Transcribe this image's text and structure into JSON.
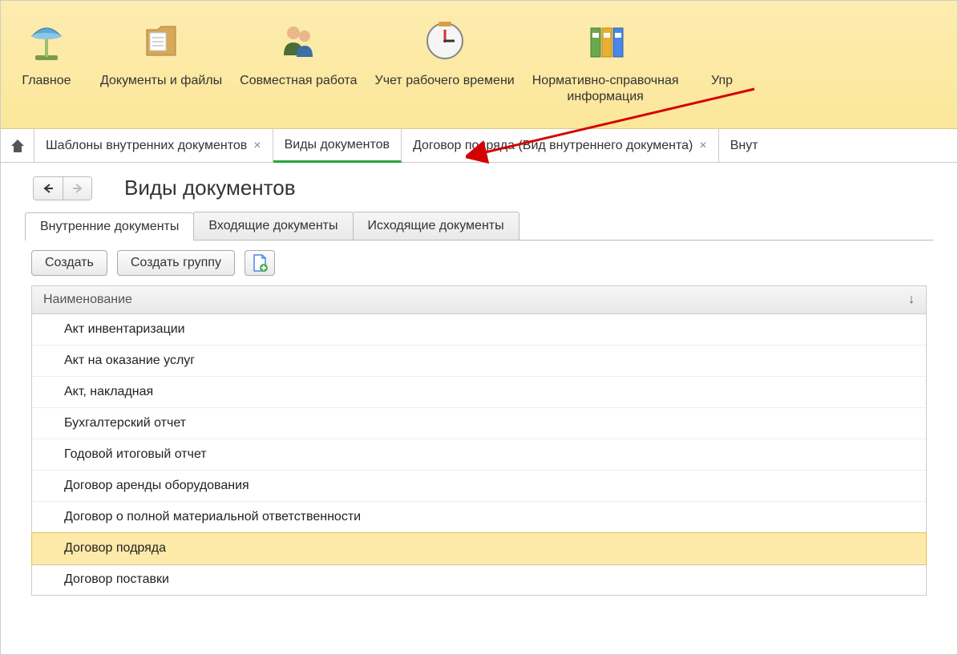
{
  "ribbon": [
    {
      "label": "Главное",
      "icon": "lamp"
    },
    {
      "label": "Документы и файлы",
      "icon": "folder"
    },
    {
      "label": "Совместная работа",
      "icon": "people"
    },
    {
      "label": "Учет рабочего времени",
      "icon": "clock"
    },
    {
      "label": "Нормативно-справочная\nинформация",
      "icon": "binders"
    },
    {
      "label": "Упр",
      "icon": "none"
    }
  ],
  "tabs": [
    {
      "label": "Шаблоны внутренних документов",
      "closable": true,
      "active": false
    },
    {
      "label": "Виды документов",
      "closable": false,
      "active": true
    },
    {
      "label": "Договор подряда (Вид внутреннего документа)",
      "closable": true,
      "active": false
    },
    {
      "label": "Внут",
      "closable": false,
      "active": false
    }
  ],
  "page_title": "Виды документов",
  "inner_tabs": [
    {
      "label": "Внутренние документы",
      "active": true
    },
    {
      "label": "Входящие документы",
      "active": false
    },
    {
      "label": "Исходящие документы",
      "active": false
    }
  ],
  "toolbar": {
    "create": "Создать",
    "create_group": "Создать группу"
  },
  "table": {
    "header": "Наименование",
    "rows": [
      {
        "label": "Акт инвентаризации",
        "selected": false
      },
      {
        "label": "Акт на оказание услуг",
        "selected": false
      },
      {
        "label": "Акт, накладная",
        "selected": false
      },
      {
        "label": "Бухгалтерский отчет",
        "selected": false
      },
      {
        "label": "Годовой итоговый отчет",
        "selected": false
      },
      {
        "label": "Договор аренды оборудования",
        "selected": false
      },
      {
        "label": "Договор о полной материальной ответственности",
        "selected": false
      },
      {
        "label": "Договор подряда",
        "selected": true
      },
      {
        "label": "Договор поставки",
        "selected": false
      }
    ]
  }
}
